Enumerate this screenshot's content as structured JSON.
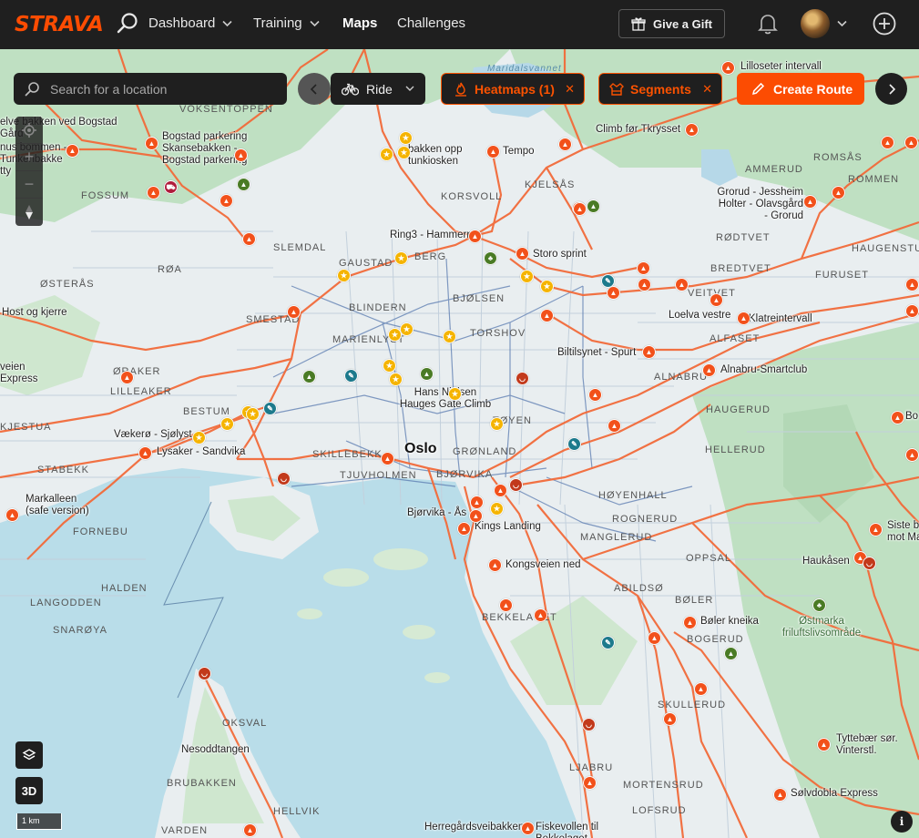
{
  "brand": {
    "logo_text": "STRAVA",
    "accent_color": "#fc4c02"
  },
  "nav": {
    "items": [
      {
        "label": "Dashboard",
        "has_menu": true,
        "active": false
      },
      {
        "label": "Training",
        "has_menu": true,
        "active": false
      },
      {
        "label": "Maps",
        "has_menu": false,
        "active": true
      },
      {
        "label": "Challenges",
        "has_menu": false,
        "active": false
      }
    ],
    "gift_label": "Give a Gift"
  },
  "toolbar": {
    "search_placeholder": "Search for a location",
    "sport": "Ride",
    "heatmaps_label": "Heatmaps (1)",
    "segments_label": "Segments",
    "create_route_label": "Create Route"
  },
  "map": {
    "area_labels": [
      "VOKSENTOPPEN",
      "FOSSUM",
      "SLEMDAL",
      "RØA",
      "ØSTERÅS",
      "SMESTAD",
      "KORSVOLL",
      "KJELSÅS",
      "GAUSTAD",
      "BERG",
      "BJØLSEN",
      "BLINDERN",
      "MARIENLYST",
      "TORSHOV",
      "ØRAKER",
      "LILLEAKER",
      "BESTUM",
      "KJESTUA",
      "STABEKK",
      "SKILLEBEKK",
      "TJUVHOLMEN",
      "BJØRVIKA",
      "GRØNLAND",
      "TØYEN",
      "HØYENHALL",
      "ROGNERUD",
      "MANGLERUD",
      "OPPSAL",
      "ABILDSØ",
      "BØLER",
      "BOGERUD",
      "SKULLERUD",
      "FORNEBU",
      "HALDEN",
      "LANGODDEN",
      "SNARØYA",
      "BEKKELAGET",
      "LJABRU",
      "MORTENSRUD",
      "LOFSRUD",
      "OKSVAL",
      "BRUBAKKEN",
      "HELLVIK",
      "VARDEN",
      "AMMERUD",
      "ROMSÅS",
      "ROMMEN",
      "RØDTVET",
      "BREDTVET",
      "VEITVET",
      "HAUGENSTUA",
      "FURUSET",
      "ALFASET",
      "ALNABRU",
      "HAUGERUD",
      "HELLERUD"
    ],
    "city_label": "Oslo",
    "water_labels": [
      "Maridalsvannet"
    ],
    "poi_labels": [
      "Lilloseter intervall",
      "Climb før Tkrysset",
      "Tempo",
      "elve bakken ved Bogstad Gård",
      "Bogstad parkering Skansebakken - Bogstad parkering",
      "nus bommen - Tunkenbakke tty",
      "bakken opp tunkiosken",
      "Grorud - Jessheim Holter - Olavsgård - Grorud",
      "Ring3 - Hammern",
      "Storo sprint",
      "Host og kjerre",
      "Loelva vestre",
      "Klatreintervall",
      "Biltilsynet - Spurt",
      "Alnabru-Smartclub",
      "veien Express",
      "Hans Nielsen Hauges Gate Climb",
      "Vækerø - Sjølyst",
      "Lysaker - Sandvika",
      "Markalleen (safe version)",
      "Bjørvika - Ås",
      "Kings Landing",
      "Kongsveien ned",
      "Haukåsen",
      "Siste b mot Ma",
      "Bo",
      "Bøler kneika",
      "Østmarka friluftslivsområde",
      "Nesoddtangen",
      "Tyttebær sør. Vinterstl.",
      "Sølvdobla Express",
      "Herregårdsveibakken",
      "Fiskevollen til Bekkelaget"
    ]
  },
  "controls": {
    "btn_3d": "3D",
    "scale": "1 km",
    "info": "i"
  }
}
